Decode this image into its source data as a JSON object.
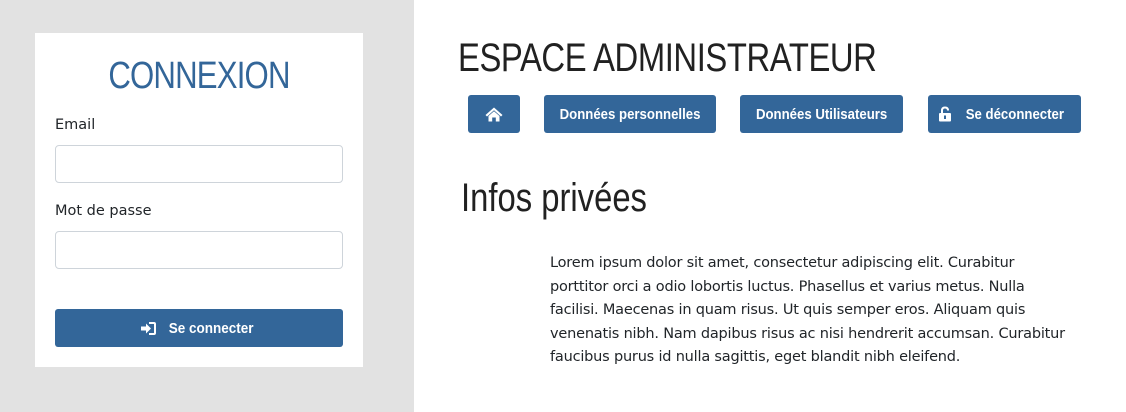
{
  "login": {
    "title": "CONNEXION",
    "email_label": "Email",
    "email_value": "",
    "password_label": "Mot de passe",
    "password_value": "",
    "submit_label": "Se connecter",
    "submit_icon": "sign-in-icon"
  },
  "header": {
    "title": "ESPACE ADMINISTRATEUR"
  },
  "nav": {
    "home_icon": "home-icon",
    "personal_label": "Données personnelles",
    "users_label": "Données Utilisateurs",
    "logout_label": "Se déconnecter",
    "logout_icon": "unlock-icon"
  },
  "main": {
    "section_title": "Infos privées",
    "section_text": "Lorem ipsum dolor sit amet, consectetur adipiscing elit. Curabitur porttitor orci a odio lobortis luctus. Phasellus et varius metus. Nulla facilisi. Maecenas in quam risus. Ut quis semper eros. Aliquam quis venenatis nibh. Nam dapibus risus ac nisi hendrerit accumsan. Curabitur faucibus purus id nulla sagittis, eget blandit nibh eleifend."
  },
  "colors": {
    "accent": "#336699",
    "sidebar_bg": "#e2e2e2",
    "card_bg": "#ffffff",
    "text": "#212529"
  }
}
